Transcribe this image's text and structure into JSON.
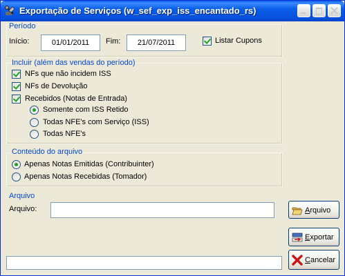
{
  "window": {
    "title": "Exportação de Serviços (w_sef_exp_iss_encantado_rs)"
  },
  "periodo": {
    "group_title": "Período",
    "inicio_label": "Início:",
    "inicio_value": "01/01/2011",
    "fim_label": "Fim:",
    "fim_value": "21/07/2011",
    "listar_cupons_label": "Listar Cupons",
    "listar_cupons_checked": true
  },
  "incluir": {
    "group_title": "Incluir (além das vendas do período)",
    "nfs_nao_incidem_label": "NFs que não incidem ISS",
    "nfs_devolucao_label": "NFs de Devolução",
    "recebidos_label": "Recebidos (Notas de Entrada)",
    "radio_somente_iss_label": "Somente com ISS Retido",
    "radio_todas_servico_label": "Todas NFE's com Serviço (ISS)",
    "radio_todas_label": "Todas NFE's",
    "selected_radio": "Somente com ISS Retido"
  },
  "conteudo": {
    "group_title": "Conteúdo do arquivo",
    "emitidas_label": "Apenas Notas Emitidas (Contribuinter)",
    "recebidas_label": "Apenas Notas Recebidas (Tomador)",
    "selected": "Apenas Notas Emitidas (Contribuinter)"
  },
  "arquivo": {
    "group_title": "Arquivo",
    "label": "Arquivo:",
    "value": ""
  },
  "buttons": {
    "arquivo_prefix": "",
    "arquivo_mnemonic": "A",
    "arquivo_rest": "rquivo",
    "exportar_prefix": "",
    "exportar_mnemonic": "E",
    "exportar_rest": "xportar",
    "cancelar_prefix": "",
    "cancelar_mnemonic": "C",
    "cancelar_rest": "ancelar"
  },
  "icons": {
    "title": "app-wrench-icon",
    "arquivo": "folder-open-icon",
    "exportar": "export-icon",
    "cancelar": "red-x-icon"
  },
  "colors": {
    "titlebar": "#0a5ce9",
    "group_title": "#0046d5",
    "check": "#21a121",
    "window_bg": "#ece9d8"
  }
}
